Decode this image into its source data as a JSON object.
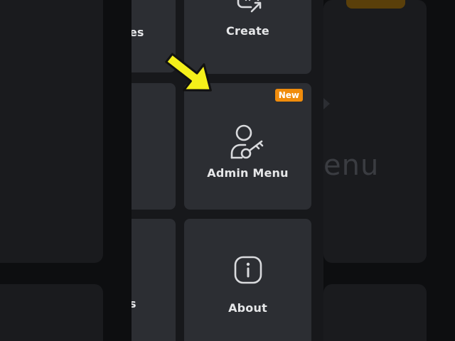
{
  "menu": {
    "tiles": [
      {
        "label": "Create",
        "icon": "create-icon"
      },
      {
        "label": "Admin Menu",
        "icon": "admin-key-icon",
        "badge": "New"
      },
      {
        "label": "About",
        "icon": "info-icon"
      }
    ],
    "cut_labels": [
      "es",
      "s"
    ]
  },
  "background": {
    "text": "enu"
  },
  "colors": {
    "accent_badge": "#f08c0c",
    "tile": "#2c2e33",
    "arrow": "#f5f01a"
  }
}
